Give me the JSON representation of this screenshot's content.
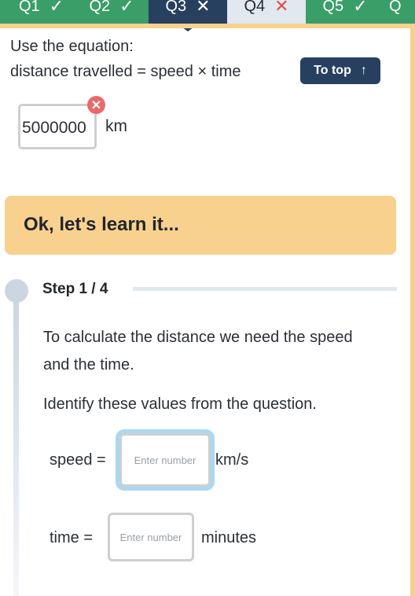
{
  "question_tabs": [
    {
      "label": "Q1",
      "status": "correct",
      "mark": "✓"
    },
    {
      "label": "Q2",
      "status": "correct",
      "mark": "✓"
    },
    {
      "label": "Q3",
      "status": "incorrect",
      "mark": "✕",
      "active": true
    },
    {
      "label": "Q4",
      "status": "incorrect",
      "mark": "✕"
    },
    {
      "label": "Q5",
      "status": "correct",
      "mark": "✓"
    },
    {
      "label": "Q",
      "status": "partial",
      "mark": ""
    }
  ],
  "question": {
    "line1": "Use the equation:",
    "line2": "distance travelled = speed × time",
    "to_top_label": "To top",
    "to_top_icon": "↑",
    "answer_value": "5000000",
    "answer_unit": "km",
    "answer_status_icon": "✕"
  },
  "learn": {
    "title": "Ok, let's learn it..."
  },
  "step": {
    "label": "Step 1 / 4",
    "text1": "To calculate the distance we need the speed and the time.",
    "text2": "Identify these values from the question.",
    "speed_label": "speed =",
    "speed_placeholder": "Enter number",
    "speed_unit": "km/s",
    "time_label": "time =",
    "time_placeholder": "Enter number",
    "time_unit": "minutes"
  },
  "colors": {
    "correct_green": "#3a9e69",
    "active_navy": "#27405f",
    "incorrect_red": "#e04e4e",
    "accent_yellow": "#f8d18e",
    "focus_blue": "#a9d9f2"
  }
}
